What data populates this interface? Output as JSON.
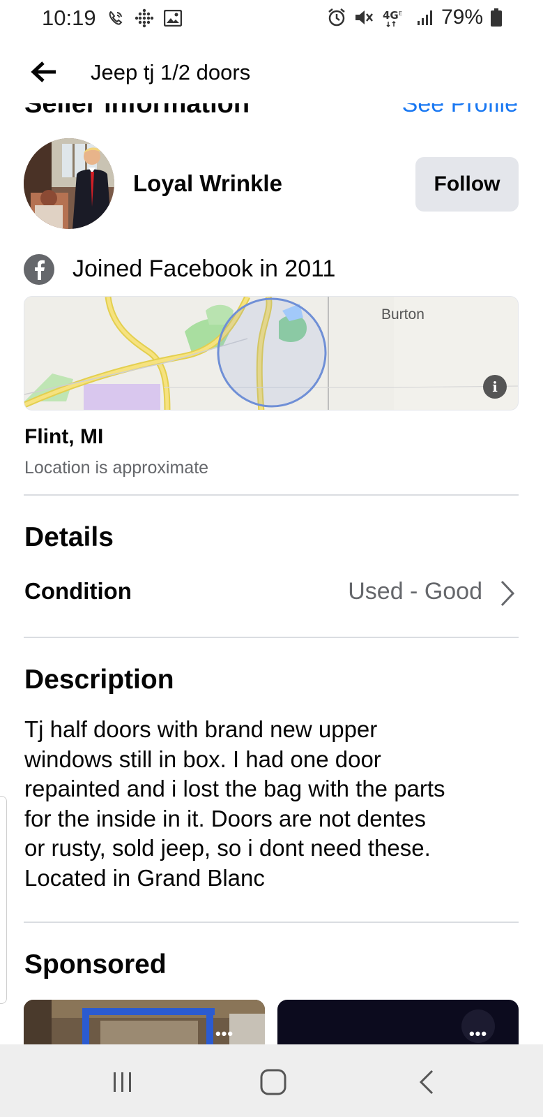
{
  "status_bar": {
    "time": "10:19",
    "battery_percent": "79%",
    "icons": [
      "wifi-call-icon",
      "dots-grid-icon",
      "image-icon",
      "alarm-icon",
      "mute-icon",
      "4g-icon",
      "signal-icon",
      "battery-icon"
    ]
  },
  "header": {
    "title": "Jeep tj 1/2 doors",
    "back_icon": "arrow-left-icon"
  },
  "seller": {
    "section_title": "Seller information",
    "see_profile_label": "See Profile",
    "name": "Loyal Wrinkle",
    "follow_label": "Follow",
    "joined_text": "Joined Facebook in 2011"
  },
  "map": {
    "town_label": "Burton",
    "info_icon_label": "i"
  },
  "location": {
    "city": "Flint, MI",
    "note": "Location is approximate"
  },
  "details": {
    "section_title": "Details",
    "condition_label": "Condition",
    "condition_value": "Used - Good"
  },
  "description": {
    "section_title": "Description",
    "lines": [
      "Tj half doors with brand new upper",
      "windows still in box.  I had one door",
      "repainted and i lost the bag with the parts",
      "for the inside in it.  Doors are not dentes",
      "or rusty, sold jeep, so i dont need these.",
      "Located in Grand Blanc"
    ]
  },
  "sponsored": {
    "section_title": "Sponsored",
    "card_menu_label": "•••"
  },
  "nav_bar": {
    "buttons": [
      "recent-apps-icon",
      "home-icon",
      "back-icon"
    ]
  },
  "colors": {
    "accent": "#1877f2",
    "secondary_text": "#65676b",
    "button_bg": "#e4e6eb",
    "divider": "#dadde1"
  }
}
